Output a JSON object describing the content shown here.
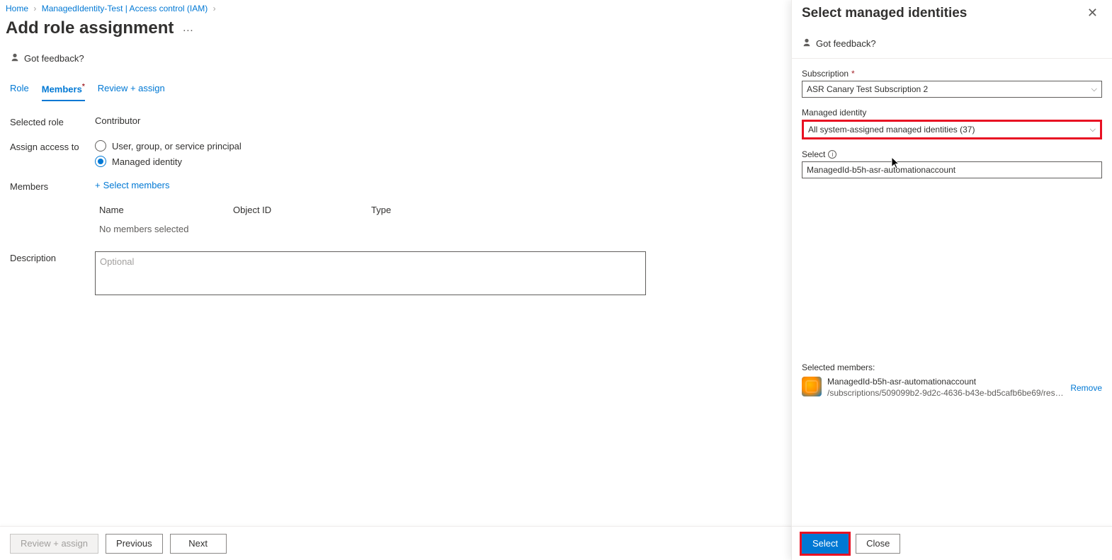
{
  "breadcrumb": {
    "home": "Home",
    "resource": "ManagedIdentity-Test | Access control (IAM)"
  },
  "page": {
    "title": "Add role assignment",
    "ellipsis": "…"
  },
  "feedback_label": "Got feedback?",
  "tabs": {
    "role": "Role",
    "members": "Members",
    "review": "Review + assign"
  },
  "form": {
    "selected_role_label": "Selected role",
    "selected_role_value": "Contributor",
    "assign_to_label": "Assign access to",
    "radio_user": "User, group, or service principal",
    "radio_mi": "Managed identity",
    "members_label": "Members",
    "select_members": "Select members",
    "table": {
      "name": "Name",
      "oid": "Object ID",
      "type": "Type",
      "empty": "No members selected"
    },
    "description_label": "Description",
    "description_placeholder": "Optional"
  },
  "footer": {
    "review": "Review + assign",
    "previous": "Previous",
    "next": "Next"
  },
  "panel": {
    "title": "Select managed identities",
    "feedback": "Got feedback?",
    "subscription_label": "Subscription",
    "subscription_value": "ASR Canary Test Subscription 2",
    "mi_label": "Managed identity",
    "mi_value": "All system-assigned managed identities (37)",
    "select_label": "Select",
    "select_value": "ManagedId-b5h-asr-automationaccount",
    "selected_members_label": "Selected members:",
    "member_name": "ManagedId-b5h-asr-automationaccount",
    "member_path": "/subscriptions/509099b2-9d2c-4636-b43e-bd5cafb6be69/resourceGroups…",
    "remove": "Remove",
    "select_btn": "Select",
    "close_btn": "Close"
  }
}
